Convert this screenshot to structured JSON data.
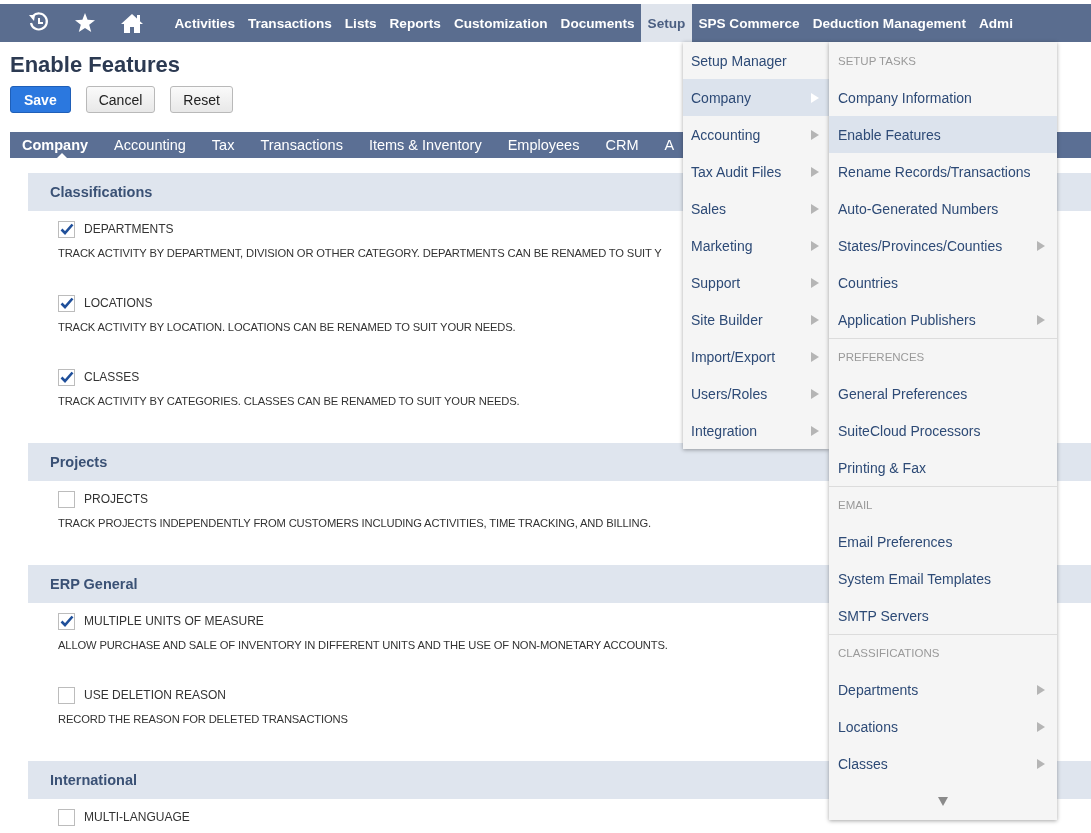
{
  "nav": {
    "icons": [
      {
        "kind": "recent"
      },
      {
        "kind": "star"
      },
      {
        "kind": "home"
      }
    ],
    "items": [
      {
        "label": "Activities",
        "selected": false
      },
      {
        "label": "Transactions",
        "selected": false
      },
      {
        "label": "Lists",
        "selected": false
      },
      {
        "label": "Reports",
        "selected": false
      },
      {
        "label": "Customization",
        "selected": false
      },
      {
        "label": "Documents",
        "selected": false
      },
      {
        "label": "Setup",
        "selected": true
      },
      {
        "label": "SPS Commerce",
        "selected": false
      },
      {
        "label": "Deduction Management",
        "selected": false
      },
      {
        "label": "Admi",
        "selected": false
      }
    ]
  },
  "page_title": "Enable Features",
  "buttons": [
    {
      "label": "Save",
      "kind": "primary"
    },
    {
      "label": "Cancel",
      "kind": "secondary"
    },
    {
      "label": "Reset",
      "kind": "secondary"
    }
  ],
  "tabs": [
    {
      "label": "Company",
      "selected": true
    },
    {
      "label": "Accounting",
      "selected": false
    },
    {
      "label": "Tax",
      "selected": false
    },
    {
      "label": "Transactions",
      "selected": false
    },
    {
      "label": "Items & Inventory",
      "selected": false
    },
    {
      "label": "Employees",
      "selected": false
    },
    {
      "label": "CRM",
      "selected": false
    },
    {
      "label": "A",
      "selected": false
    }
  ],
  "sections": [
    {
      "title": "Classifications",
      "features": [
        {
          "label": "DEPARTMENTS",
          "checked": true,
          "description": "TRACK ACTIVITY BY DEPARTMENT, DIVISION OR OTHER CATEGORY. DEPARTMENTS CAN BE RENAMED TO SUIT Y"
        },
        {
          "label": "LOCATIONS",
          "checked": true,
          "description": "TRACK ACTIVITY BY LOCATION. LOCATIONS CAN BE RENAMED TO SUIT YOUR NEEDS."
        },
        {
          "label": "CLASSES",
          "checked": true,
          "description": "TRACK ACTIVITY BY CATEGORIES. CLASSES CAN BE RENAMED TO SUIT YOUR NEEDS."
        }
      ]
    },
    {
      "title": "Projects",
      "features": [
        {
          "label": "PROJECTS",
          "checked": false,
          "description": "TRACK PROJECTS INDEPENDENTLY FROM CUSTOMERS INCLUDING ACTIVITIES, TIME TRACKING, AND BILLING."
        }
      ]
    },
    {
      "title": "ERP General",
      "features": [
        {
          "label": "MULTIPLE UNITS OF MEASURE",
          "checked": true,
          "description": "ALLOW PURCHASE AND SALE OF INVENTORY IN DIFFERENT UNITS AND THE USE OF NON-MONETARY ACCOUNTS."
        },
        {
          "label": "USE DELETION REASON",
          "checked": false,
          "description": "RECORD THE REASON FOR DELETED TRANSACTIONS"
        }
      ]
    },
    {
      "title": "International",
      "features": [
        {
          "label": "MULTI-LANGUAGE",
          "checked": false
        }
      ]
    }
  ],
  "setup_menu": {
    "items": [
      {
        "label": "Setup Manager",
        "submenu": false,
        "selected": false
      },
      {
        "label": "Company",
        "submenu": true,
        "selected": true
      },
      {
        "label": "Accounting",
        "submenu": true,
        "selected": false
      },
      {
        "label": "Tax Audit Files",
        "submenu": true,
        "selected": false
      },
      {
        "label": "Sales",
        "submenu": true,
        "selected": false
      },
      {
        "label": "Marketing",
        "submenu": true,
        "selected": false
      },
      {
        "label": "Support",
        "submenu": true,
        "selected": false
      },
      {
        "label": "Site Builder",
        "submenu": true,
        "selected": false
      },
      {
        "label": "Import/Export",
        "submenu": true,
        "selected": false
      },
      {
        "label": "Users/Roles",
        "submenu": true,
        "selected": false
      },
      {
        "label": "Integration",
        "submenu": true,
        "selected": false
      }
    ]
  },
  "company_submenu": {
    "items": [
      {
        "kind": "header",
        "label": "SETUP TASKS"
      },
      {
        "kind": "item",
        "label": "Company Information",
        "submenu": false,
        "selected": false
      },
      {
        "kind": "item",
        "label": "Enable Features",
        "submenu": false,
        "selected": true
      },
      {
        "kind": "item",
        "label": "Rename Records/Transactions",
        "submenu": false,
        "selected": false
      },
      {
        "kind": "item",
        "label": "Auto-Generated Numbers",
        "submenu": false,
        "selected": false
      },
      {
        "kind": "item",
        "label": "States/Provinces/Counties",
        "submenu": true,
        "selected": false
      },
      {
        "kind": "item",
        "label": "Countries",
        "submenu": false,
        "selected": false
      },
      {
        "kind": "item",
        "label": "Application Publishers",
        "submenu": true,
        "selected": false
      },
      {
        "kind": "header",
        "label": "PREFERENCES"
      },
      {
        "kind": "item",
        "label": "General Preferences",
        "submenu": false,
        "selected": false
      },
      {
        "kind": "item",
        "label": "SuiteCloud Processors",
        "submenu": false,
        "selected": false
      },
      {
        "kind": "item",
        "label": "Printing & Fax",
        "submenu": false,
        "selected": false
      },
      {
        "kind": "header",
        "label": "EMAIL"
      },
      {
        "kind": "item",
        "label": "Email Preferences",
        "submenu": false,
        "selected": false
      },
      {
        "kind": "item",
        "label": "System Email Templates",
        "submenu": false,
        "selected": false
      },
      {
        "kind": "item",
        "label": "SMTP Servers",
        "submenu": false,
        "selected": false
      },
      {
        "kind": "header",
        "label": "CLASSIFICATIONS"
      },
      {
        "kind": "item",
        "label": "Departments",
        "submenu": true,
        "selected": false
      },
      {
        "kind": "item",
        "label": "Locations",
        "submenu": true,
        "selected": false
      },
      {
        "kind": "item",
        "label": "Classes",
        "submenu": true,
        "selected": false
      }
    ],
    "more_below": true
  }
}
